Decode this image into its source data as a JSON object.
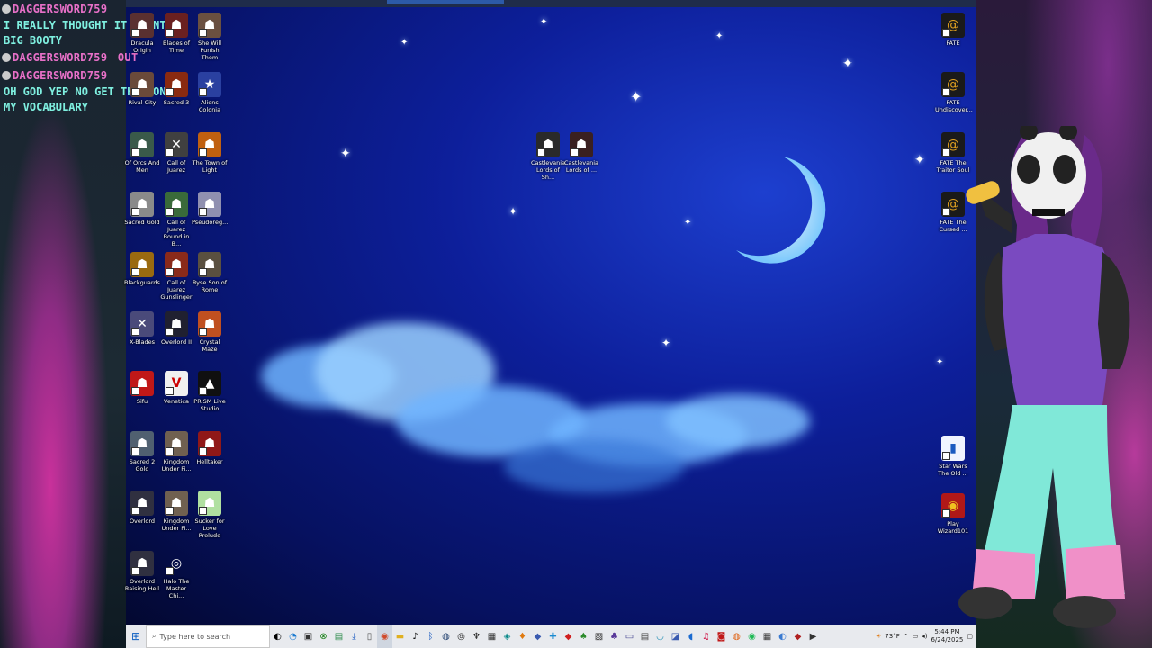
{
  "chat": {
    "messages": [
      {
        "user": "DAGGERSWORD759",
        "text": "I REALLY THOUGHT IT MEANT BIG BOOTY"
      },
      {
        "user": "DAGGERSWORD759",
        "text": "OUT"
      },
      {
        "user": "DAGGERSWORD759",
        "text": "OH GOD YEP NO GET THAT ON MY VOCABULARY"
      }
    ]
  },
  "desktop_icons": {
    "col1": [
      "Dracula Origin",
      "Rival City",
      "Of Orcs And Men",
      "Sacred Gold",
      "Blackguards",
      "X-Blades",
      "Sifu",
      "Sacred 2 Gold",
      "Overlord",
      "Overlord Raising Hell"
    ],
    "col2": [
      "Blades of Time",
      "Sacred 3",
      "Call of Juarez",
      "Call of Juarez Bound in B...",
      "Call of Juarez Gunslinger",
      "Overlord II",
      "Venetica",
      "Kingdom Under Fi...",
      "Kingdom Under Fi...",
      "Halo The Master Chi..."
    ],
    "col3": [
      "She Will Punish Them",
      "Aliens Colonia",
      "The Town of Light",
      "Pseudoreg...",
      "Ryse Son of Rome",
      "Crystal Maze",
      "PRISM Live Studio",
      "Helltaker",
      "Sucker for Love Prelude"
    ],
    "middle": [
      "Castlevania Lords of Sh...",
      "Castlevania Lords of ..."
    ],
    "right": [
      "FATE",
      "FATE Undiscover...",
      "FATE The Traitor Soul",
      "FATE The Cursed ...",
      "Star Wars The Old ...",
      "Play Wizard101"
    ]
  },
  "taskbar": {
    "search_placeholder": "Type here to search",
    "weather": "73°F",
    "time": "5:44 PM",
    "date": "6/24/2025"
  },
  "colors": {
    "chat_name": "#e870c8",
    "chat_text": "#7ff0e0",
    "taskbar_bg": "#e8eaee"
  }
}
